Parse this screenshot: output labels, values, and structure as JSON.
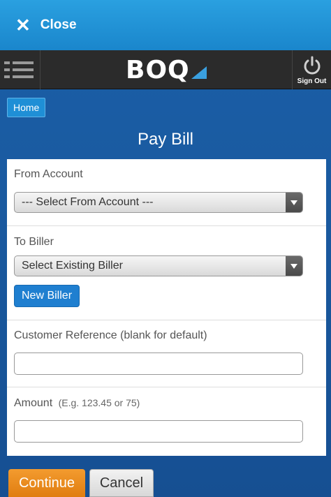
{
  "topbar": {
    "close_label": "Close",
    "close_icon": "close-icon"
  },
  "appbar": {
    "menu_icon": "hamburger-menu-icon",
    "logo_text": "BOQ",
    "signout_label": "Sign Out",
    "signout_icon": "power-icon"
  },
  "breadcrumb": {
    "home_label": "Home"
  },
  "page": {
    "title": "Pay Bill"
  },
  "form": {
    "from_account": {
      "label": "From Account",
      "selected": "--- Select From Account ---"
    },
    "to_biller": {
      "label": "To Biller",
      "selected": "Select Existing Biller",
      "new_biller_label": "New Biller"
    },
    "customer_reference": {
      "label": "Customer Reference (blank for default)",
      "value": ""
    },
    "amount": {
      "label": "Amount",
      "hint": "(E.g. 123.45 or 75)",
      "value": ""
    }
  },
  "actions": {
    "continue_label": "Continue",
    "cancel_label": "Cancel"
  },
  "colors": {
    "accent": "#1f8fd6",
    "continue": "#f0922a",
    "background": "#1a5aa0"
  }
}
